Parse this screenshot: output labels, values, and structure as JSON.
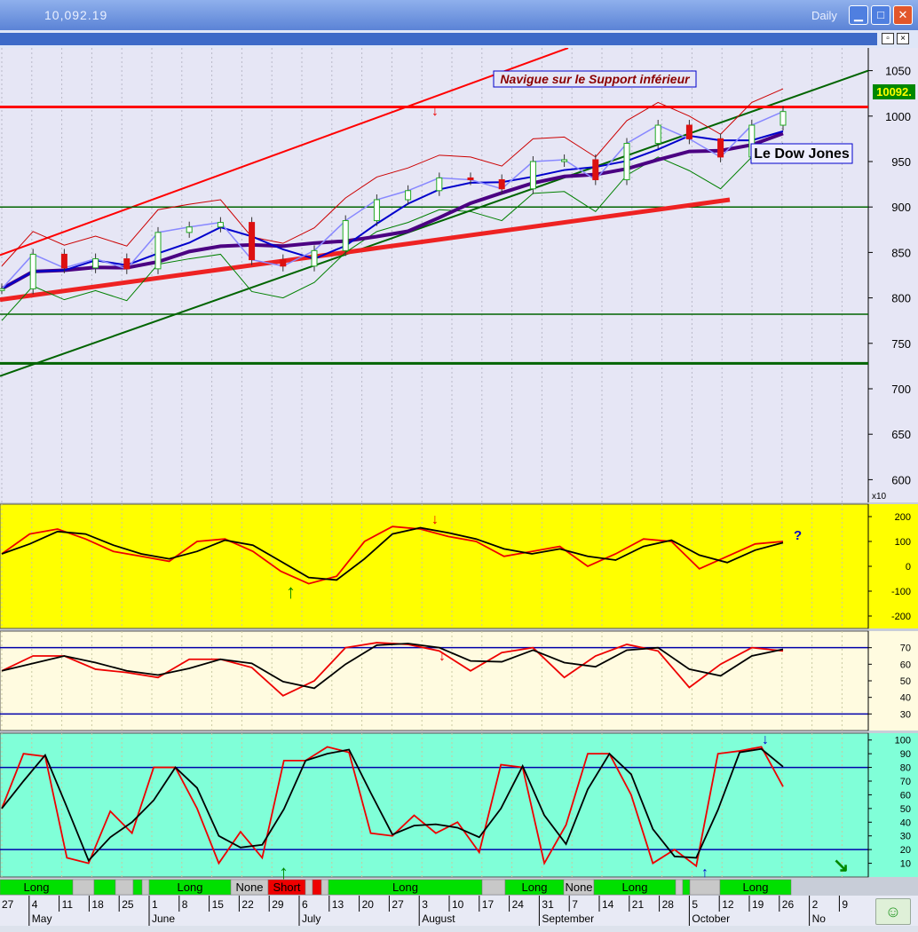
{
  "window": {
    "title": "10,092.19",
    "period": "Daily",
    "minimize_icon": "minimize-icon",
    "maximize_icon": "maximize-icon",
    "close_icon": "close-icon"
  },
  "colors": {
    "price_bg": "#e6e6f5",
    "cci_bg": "#ffff00",
    "rsi_bg": "#fffbe0",
    "stoch_bg": "#80ffd8",
    "resistance": "#ff0000",
    "trend": "#006400",
    "ma_fast": "#0000cc",
    "ma_slow": "#4b0082"
  },
  "chart_data": [
    {
      "type": "candlestick",
      "title": "Le Dow Jones",
      "annotation": "Navigue sur le Support inférieur",
      "last_value_label": "10092.",
      "scale_label": "x10",
      "ylim": [
        575,
        1075
      ],
      "y_ticks": [
        1050,
        1000,
        950,
        900,
        850,
        800,
        750,
        700,
        650,
        600
      ],
      "x": [
        "27 Apr",
        "4 May",
        "11 May",
        "18 May",
        "25 May",
        "1 Jun",
        "8 Jun",
        "15 Jun",
        "22 Jun",
        "29 Jun",
        "6 Jul",
        "13 Jul",
        "20 Jul",
        "27 Jul",
        "3 Aug",
        "10 Aug",
        "17 Aug",
        "24 Aug",
        "31 Aug",
        "7 Sep",
        "14 Sep",
        "21 Sep",
        "28 Sep",
        "5 Oct",
        "12 Oct",
        "16 Oct"
      ],
      "close": [
        810,
        848,
        833,
        843,
        832,
        872,
        878,
        883,
        842,
        835,
        852,
        885,
        908,
        918,
        932,
        930,
        920,
        950,
        952,
        930,
        970,
        990,
        975,
        955,
        990,
        1005
      ],
      "horizontal_lines": [
        1010,
        900,
        782,
        728
      ],
      "bearish_arrows_at": [
        "3 Aug"
      ]
    },
    {
      "type": "line",
      "name_hint": "oscillator",
      "ylim": [
        -250,
        250
      ],
      "y_ticks": [
        200,
        100,
        0,
        -100,
        -200
      ],
      "annotation": "?",
      "series": [
        {
          "values": [
            50,
            130,
            150,
            110,
            60,
            40,
            20,
            100,
            110,
            60,
            -20,
            -70,
            -40,
            100,
            160,
            150,
            120,
            100,
            40,
            60,
            80,
            0,
            50,
            110,
            100,
            -10,
            40,
            90,
            100
          ]
        }
      ],
      "bullish_arrows_at": [
        "22 Jun"
      ],
      "bearish_arrows_at": [
        "3 Aug"
      ]
    },
    {
      "type": "line",
      "ylim": [
        20,
        80
      ],
      "y_ticks": [
        70,
        60,
        50,
        40,
        30
      ],
      "reference_lines": [
        70,
        30
      ],
      "series": [
        {
          "values": [
            56,
            65,
            65,
            57,
            55,
            52,
            63,
            63,
            58,
            41,
            50,
            70,
            73,
            72,
            68,
            56,
            67,
            70,
            52,
            65,
            72,
            68,
            46,
            60,
            70,
            68
          ]
        }
      ],
      "bearish_arrows_at": [
        "10 Aug"
      ]
    },
    {
      "type": "line",
      "ylim": [
        0,
        105
      ],
      "y_ticks": [
        100,
        90,
        80,
        70,
        60,
        50,
        40,
        30,
        20,
        10
      ],
      "reference_lines": [
        80,
        20
      ],
      "series": [
        {
          "values": [
            50,
            90,
            88,
            14,
            10,
            48,
            32,
            80,
            80,
            50,
            10,
            33,
            14,
            85,
            85,
            95,
            91,
            32,
            30,
            45,
            32,
            40,
            18,
            82,
            80,
            10,
            38,
            90,
            90,
            60,
            10,
            20,
            8,
            90,
            92,
            95,
            66
          ]
        }
      ],
      "bullish_arrows_at": [
        "22 Jun",
        "5 Oct"
      ],
      "bearish_arrows_at": [
        "16 Oct"
      ]
    }
  ],
  "signal_bar": [
    {
      "label": "Long",
      "kind": "long",
      "w": 82
    },
    {
      "label": "",
      "kind": "none",
      "w": 24
    },
    {
      "label": "",
      "kind": "long",
      "w": 24
    },
    {
      "label": "",
      "kind": "none",
      "w": 20
    },
    {
      "label": "",
      "kind": "long",
      "w": 10
    },
    {
      "label": "",
      "kind": "none",
      "w": 8
    },
    {
      "label": "Long",
      "kind": "long",
      "w": 92
    },
    {
      "label": "None",
      "kind": "none",
      "w": 42
    },
    {
      "label": "Short",
      "kind": "short",
      "w": 42
    },
    {
      "label": "",
      "kind": "none",
      "w": 8
    },
    {
      "label": "",
      "kind": "short",
      "w": 10
    },
    {
      "label": "",
      "kind": "none",
      "w": 8
    },
    {
      "label": "Long",
      "kind": "long",
      "w": 173
    },
    {
      "label": "",
      "kind": "none",
      "w": 26
    },
    {
      "label": "Long",
      "kind": "long",
      "w": 66
    },
    {
      "label": "None",
      "kind": "none",
      "w": 34
    },
    {
      "label": "Long",
      "kind": "long",
      "w": 92
    },
    {
      "label": "",
      "kind": "none",
      "w": 8
    },
    {
      "label": "",
      "kind": "long",
      "w": 8
    },
    {
      "label": "",
      "kind": "none",
      "w": 34
    },
    {
      "label": "Long",
      "kind": "long",
      "w": 80
    }
  ],
  "x_axis": {
    "days": [
      "27",
      "4",
      "11",
      "18",
      "25",
      "1",
      "8",
      "15",
      "22",
      "29",
      "6",
      "13",
      "20",
      "27",
      "3",
      "10",
      "17",
      "24",
      "31",
      "7",
      "14",
      "21",
      "28",
      "5",
      "12",
      "19",
      "26",
      "2",
      "9"
    ],
    "months": [
      "May",
      "June",
      "July",
      "August",
      "September",
      "October",
      "No"
    ]
  },
  "smiley_icon": "☺"
}
